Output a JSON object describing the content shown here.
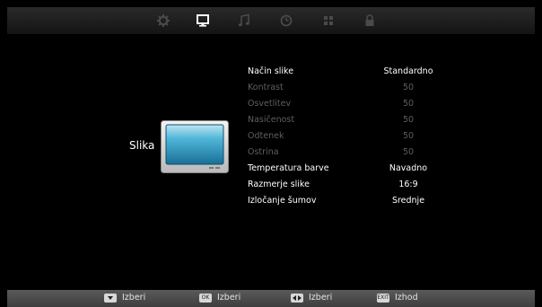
{
  "section": {
    "title": "Slika"
  },
  "rows": [
    {
      "label": "Način slike",
      "value": "Standardno",
      "state": "active"
    },
    {
      "label": "Kontrast",
      "value": "50",
      "state": "dim"
    },
    {
      "label": "Osvetlitev",
      "value": "50",
      "state": "dim"
    },
    {
      "label": "Nasičenost",
      "value": "50",
      "state": "dim"
    },
    {
      "label": "Odtenek",
      "value": "50",
      "state": "dim"
    },
    {
      "label": "Ostrina",
      "value": "50",
      "state": "dim"
    },
    {
      "label": "Temperatura barve",
      "value": "Navadno",
      "state": "active"
    },
    {
      "label": "Razmerje slike",
      "value": "16:9",
      "state": "active"
    },
    {
      "label": "Izločanje šumov",
      "value": "Srednje",
      "state": "active"
    }
  ],
  "tabs": [
    {
      "icon": "gear-icon",
      "active": false
    },
    {
      "icon": "monitor-icon",
      "active": true
    },
    {
      "icon": "music-note-icon",
      "active": false
    },
    {
      "icon": "clock-icon",
      "active": false
    },
    {
      "icon": "grid-icon",
      "active": false
    },
    {
      "icon": "lock-icon",
      "active": false
    }
  ],
  "footer": {
    "hints": [
      {
        "key": "",
        "text": "Izberi",
        "icon": "down-arrow-key-icon"
      },
      {
        "key": "OK",
        "text": "Izberi",
        "icon": "ok-key-icon"
      },
      {
        "key": "",
        "text": "Izberi",
        "icon": "left-right-arrow-key-icon"
      },
      {
        "key": "EXIT",
        "text": "Izhod",
        "icon": "exit-key-icon"
      }
    ]
  },
  "colors": {
    "active": "#ffffff",
    "dim": "#5f5f5f",
    "tab_active": "#ffffff",
    "tab_inactive": "#4a4a4a"
  }
}
